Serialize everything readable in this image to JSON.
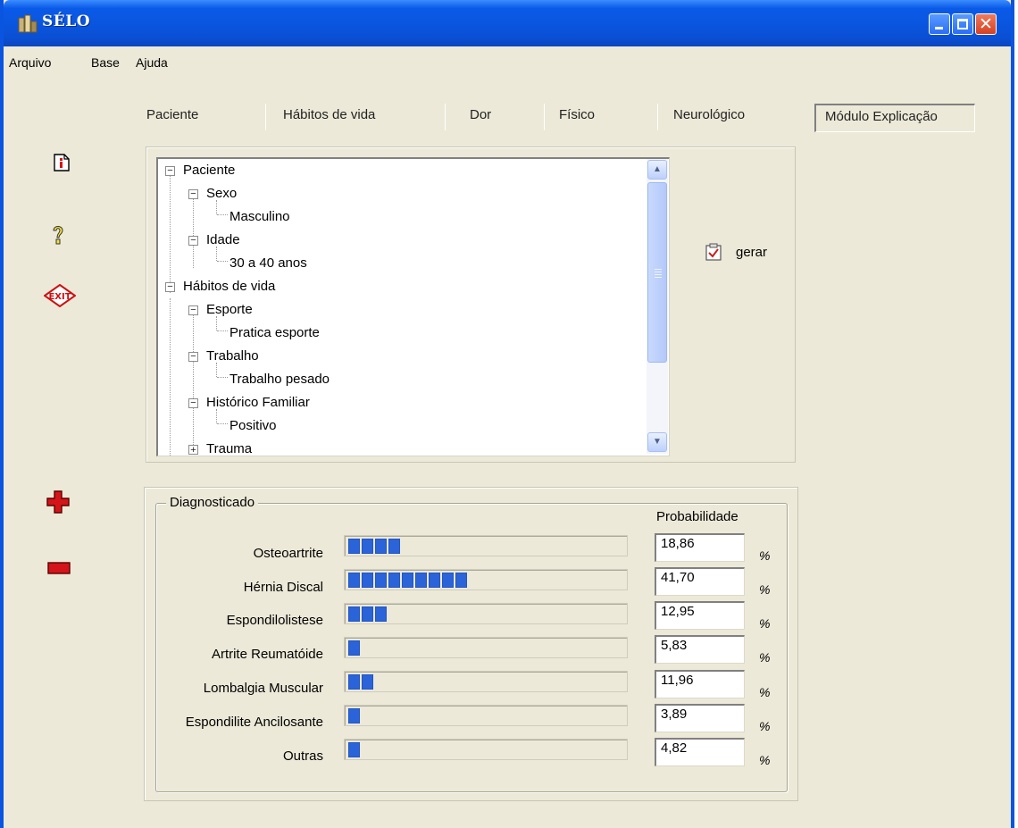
{
  "window": {
    "title": "SÉLO",
    "close_glyph": "✕"
  },
  "menu": [
    "Arquivo",
    "Base",
    "Ajuda"
  ],
  "sidebar": [
    {
      "icon": "info-document-icon"
    },
    {
      "icon": "help-bulb-icon"
    },
    {
      "icon": "exit-icon",
      "text": "EXIT"
    },
    {
      "icon": "add-plus-icon"
    },
    {
      "icon": "remove-minus-icon"
    }
  ],
  "tabs": [
    {
      "label": "Paciente"
    },
    {
      "label": "Hábitos de vida"
    },
    {
      "label": "Dor"
    },
    {
      "label": "Físico"
    },
    {
      "label": "Neurológico"
    },
    {
      "label": "Módulo Explicação",
      "active": true
    }
  ],
  "tree": {
    "expand_glyph": "−",
    "collapsed_glyph": "+",
    "nodes": [
      {
        "label": "Paciente",
        "level": 0,
        "expander": "minus"
      },
      {
        "label": "Sexo",
        "level": 1,
        "expander": "minus"
      },
      {
        "label": "Masculino",
        "level": 2,
        "expander": "none"
      },
      {
        "label": "Idade",
        "level": 1,
        "expander": "minus"
      },
      {
        "label": "30 a 40 anos",
        "level": 2,
        "expander": "none"
      },
      {
        "label": "Hábitos de vida",
        "level": 0,
        "expander": "minus"
      },
      {
        "label": "Esporte",
        "level": 1,
        "expander": "minus"
      },
      {
        "label": "Pratica esporte",
        "level": 2,
        "expander": "none"
      },
      {
        "label": "Trabalho",
        "level": 1,
        "expander": "minus"
      },
      {
        "label": "Trabalho pesado",
        "level": 2,
        "expander": "none"
      },
      {
        "label": "Histórico Familiar",
        "level": 1,
        "expander": "minus"
      },
      {
        "label": "Positivo",
        "level": 2,
        "expander": "none"
      },
      {
        "label": "Trauma",
        "level": 1,
        "expander": "plus"
      }
    ],
    "scroll_up": "▲",
    "scroll_down": "▼"
  },
  "gerar": {
    "label": "gerar",
    "icon": "clipboard-check-icon"
  },
  "diagnostics": {
    "group_label": "Diagnosticado",
    "probability_header": "Probabilidade",
    "percent_symbol": "%",
    "segment_color": "#2b63d8",
    "items": [
      {
        "name": "Osteoartrite",
        "value": "18,86",
        "segments": 4
      },
      {
        "name": "Hérnia Discal",
        "value": "41,70",
        "segments": 9
      },
      {
        "name": "Espondilolistese",
        "value": "12,95",
        "segments": 3
      },
      {
        "name": "Artrite Reumatóide",
        "value": "5,83",
        "segments": 1
      },
      {
        "name": "Lombalgia Muscular",
        "value": "11,96",
        "segments": 2
      },
      {
        "name": "Espondilite Ancilosante",
        "value": "3,89",
        "segments": 1
      },
      {
        "name": "Outras",
        "value": "4,82",
        "segments": 1
      }
    ]
  }
}
